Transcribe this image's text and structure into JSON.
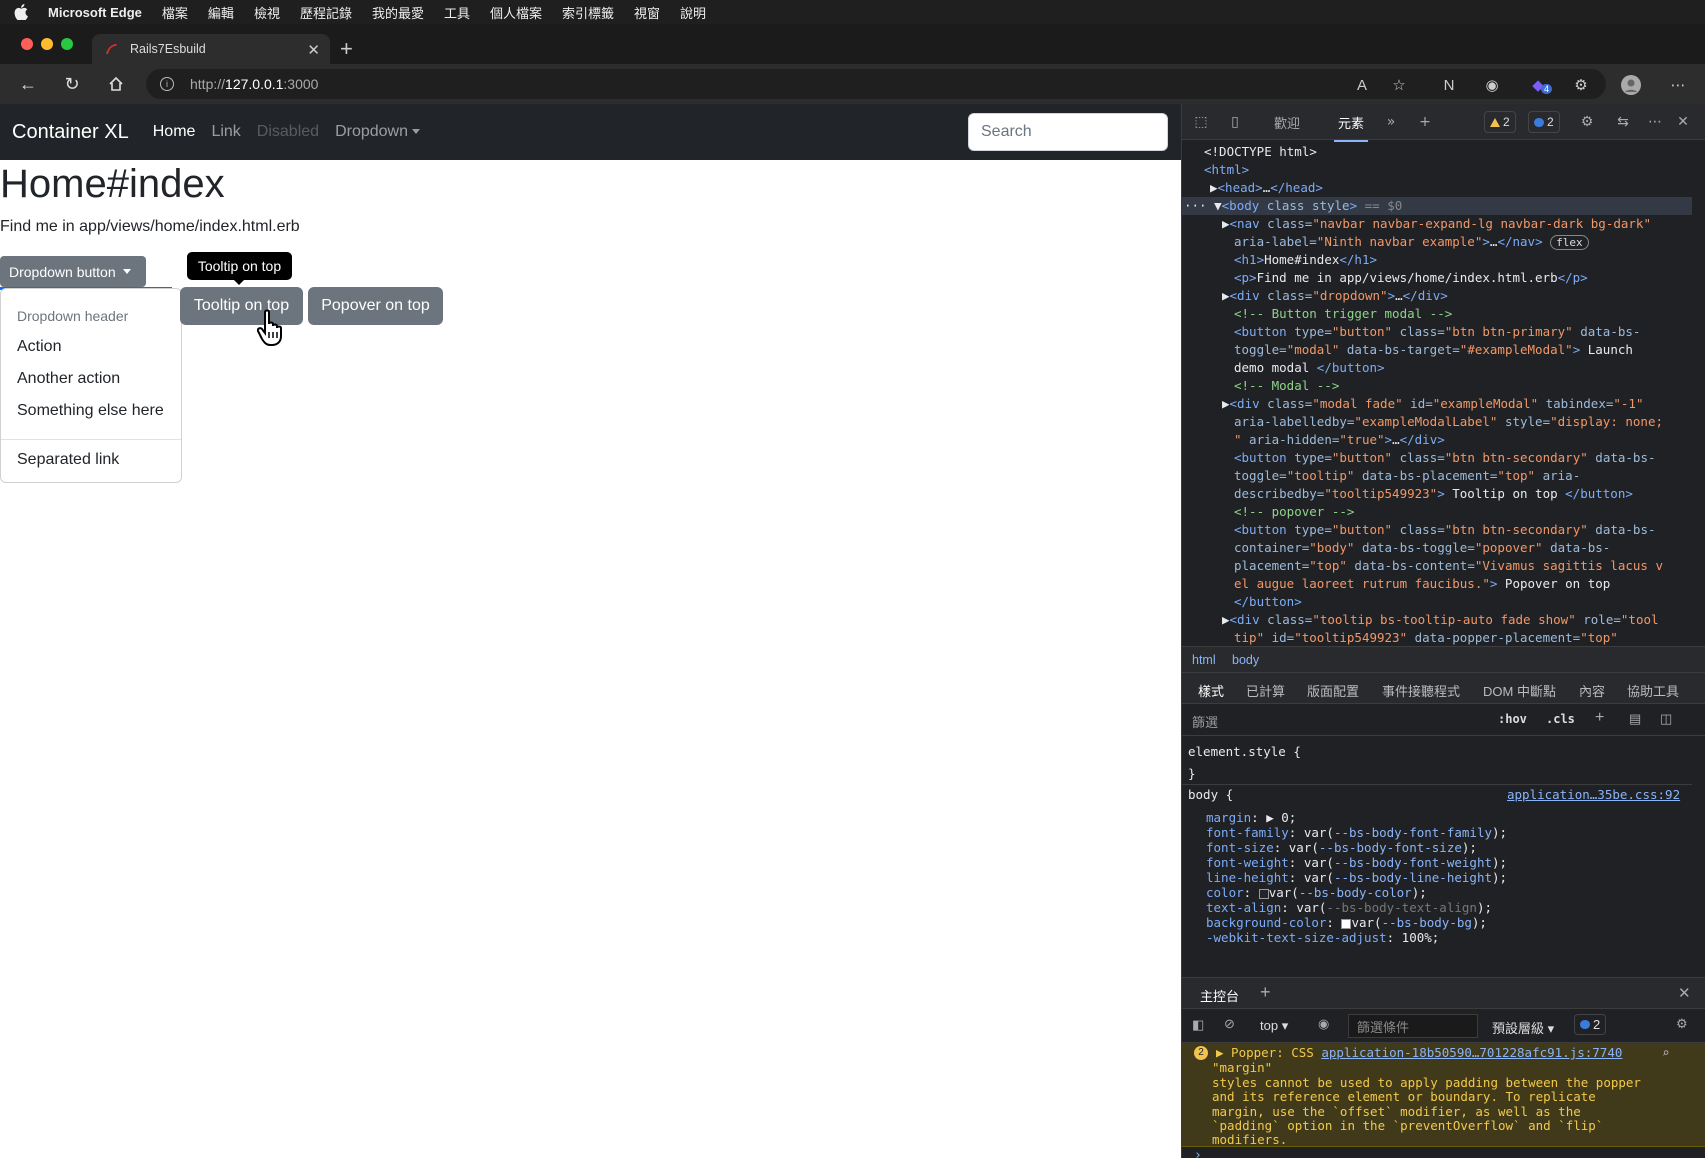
{
  "menubar": {
    "app": "Microsoft Edge",
    "items": [
      "檔案",
      "編輯",
      "檢視",
      "歷程記錄",
      "我的最愛",
      "工具",
      "個人檔案",
      "索引標籤",
      "視窗",
      "說明"
    ]
  },
  "tab": {
    "title": "Rails7Esbuild"
  },
  "address": {
    "prefix": "http://",
    "host": "127.0.0.1",
    "port": ":3000"
  },
  "toolbar_badge": "4",
  "navbar": {
    "brand": "Container XL",
    "links": [
      "Home",
      "Link",
      "Disabled",
      "Dropdown"
    ],
    "search_placeholder": "Search"
  },
  "main": {
    "title": "Home#index",
    "lead": "Find me in app/views/home/index.html.erb",
    "dropdown_button": "Dropdown button",
    "dropdown": {
      "header": "Dropdown header",
      "items": [
        "Action",
        "Another action",
        "Something else here"
      ],
      "separated": "Separated link"
    },
    "tooltip_button": "Tooltip on top",
    "popover_button": "Popover on top",
    "tooltip_text": "Tooltip on top"
  },
  "devtools": {
    "tabs": [
      "歡迎",
      "元素"
    ],
    "warnings": "2",
    "messages": "2",
    "breadcrumbs": [
      "html",
      "body"
    ],
    "style_tabs": [
      "樣式",
      "已計算",
      "版面配置",
      "事件接聽程式",
      "DOM 中斷點",
      "內容",
      "協助工具"
    ],
    "filter_placeholder": "篩選",
    "hov": ":hov",
    "cls": ".cls",
    "css_source": "application…35be.css:92",
    "console_title": "主控台",
    "console_context": "top",
    "console_filter": "篩選條件",
    "console_level": "預設層級",
    "console_count": "2",
    "warn_count": "2",
    "warn_link": "application-18b50590…701228afc91.js:7740"
  }
}
